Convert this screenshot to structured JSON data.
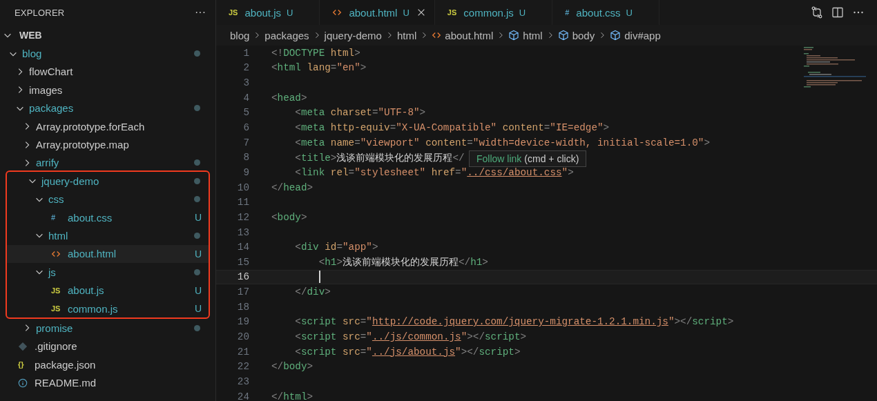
{
  "explorer": {
    "title": "EXPLORER",
    "more": "···",
    "root": {
      "name": "WEB",
      "expanded": true,
      "children": [
        {
          "name": "blog",
          "kind": "folder",
          "expanded": true,
          "modified": true,
          "selected": false,
          "children": [
            {
              "name": "flowChart",
              "kind": "folder",
              "expanded": false,
              "modified": false,
              "selected": false
            },
            {
              "name": "images",
              "kind": "folder",
              "expanded": false,
              "modified": false,
              "selected": false
            },
            {
              "name": "packages",
              "kind": "folder",
              "expanded": true,
              "modified": true,
              "selected": false,
              "children": [
                {
                  "name": "Array.prototype.forEach",
                  "kind": "folder",
                  "expanded": false,
                  "modified": false,
                  "selected": false
                },
                {
                  "name": "Array.prototype.map",
                  "kind": "folder",
                  "expanded": false,
                  "modified": false,
                  "selected": false
                },
                {
                  "name": "arrify",
                  "kind": "folder",
                  "expanded": false,
                  "modified": true,
                  "selected": false
                },
                {
                  "name": "jquery-demo",
                  "kind": "folder",
                  "expanded": true,
                  "modified": true,
                  "selected": false,
                  "highlighted": true,
                  "children": [
                    {
                      "name": "css",
                      "kind": "folder",
                      "expanded": true,
                      "modified": true,
                      "selected": false,
                      "children": [
                        {
                          "name": "about.css",
                          "kind": "css",
                          "glyph": "#",
                          "status": "U",
                          "selected": false
                        }
                      ]
                    },
                    {
                      "name": "html",
                      "kind": "folder",
                      "expanded": true,
                      "modified": true,
                      "selected": false,
                      "children": [
                        {
                          "name": "about.html",
                          "kind": "html",
                          "status": "U",
                          "selected": true
                        }
                      ]
                    },
                    {
                      "name": "js",
                      "kind": "folder",
                      "expanded": true,
                      "modified": true,
                      "selected": false,
                      "children": [
                        {
                          "name": "about.js",
                          "kind": "js",
                          "glyph": "JS",
                          "status": "U",
                          "selected": false
                        },
                        {
                          "name": "common.js",
                          "kind": "js",
                          "glyph": "JS",
                          "status": "U",
                          "selected": false
                        }
                      ]
                    }
                  ]
                },
                {
                  "name": "promise",
                  "kind": "folder",
                  "expanded": false,
                  "modified": true,
                  "selected": false
                }
              ]
            }
          ]
        },
        {
          "name": ".gitignore",
          "kind": "git",
          "selected": false
        },
        {
          "name": "package.json",
          "kind": "json",
          "glyph": "{}",
          "selected": false
        },
        {
          "name": "README.md",
          "kind": "info",
          "selected": false
        }
      ]
    }
  },
  "tabs": [
    {
      "label": "about.js",
      "kind": "js",
      "glyph": "JS",
      "status": "U",
      "selected": false
    },
    {
      "label": "about.html",
      "kind": "html",
      "status": "U",
      "selected": true
    },
    {
      "label": "common.js",
      "kind": "js",
      "glyph": "JS",
      "status": "U",
      "selected": false
    },
    {
      "label": "about.css",
      "kind": "css",
      "glyph": "#",
      "status": "U",
      "selected": false
    }
  ],
  "breadcrumbs": [
    {
      "label": "blog",
      "kind": "folder"
    },
    {
      "label": "packages",
      "kind": "folder"
    },
    {
      "label": "jquery-demo",
      "kind": "folder"
    },
    {
      "label": "html",
      "kind": "folder"
    },
    {
      "label": "about.html",
      "kind": "html"
    },
    {
      "label": "html",
      "kind": "element"
    },
    {
      "label": "body",
      "kind": "element"
    },
    {
      "label": "div#app",
      "kind": "element"
    }
  ],
  "lines": [
    {
      "number": "1",
      "current": false,
      "text": "<!DOCTYPE html>"
    },
    {
      "number": "2",
      "current": false,
      "text": "<html lang=\"en\">"
    },
    {
      "number": "3",
      "current": false
    },
    {
      "number": "4",
      "current": false,
      "text": "<head>"
    },
    {
      "number": "5",
      "current": false,
      "text": "    <meta charset=\"UTF-8\">"
    },
    {
      "number": "6",
      "current": false,
      "text": "    <meta http-equiv=\"X-UA-Compatible\" content=\"IE=edge\">"
    },
    {
      "number": "7",
      "current": false,
      "text": "    <meta name=\"viewport\" content=\"width=device-width, initial-scale=1.0\">"
    },
    {
      "number": "8",
      "current": false,
      "text": "    <title>浅谈前端模块化的发展历程</"
    },
    {
      "number": "9",
      "current": false,
      "text": "    <link rel=\"stylesheet\" href=\"../css/about.css\">"
    },
    {
      "number": "10",
      "current": false,
      "text": "</head>"
    },
    {
      "number": "11",
      "current": false
    },
    {
      "number": "12",
      "current": false,
      "text": "<body>"
    },
    {
      "number": "13",
      "current": false
    },
    {
      "number": "14",
      "current": false,
      "text": "    <div id=\"app\">"
    },
    {
      "number": "15",
      "current": false,
      "text": "        <h1>浅谈前端模块化的发展历程</h1>"
    },
    {
      "number": "16",
      "current": true
    },
    {
      "number": "17",
      "current": false,
      "text": "    </div>"
    },
    {
      "number": "18",
      "current": false
    },
    {
      "number": "19",
      "current": false,
      "text": "    <script src=\"http://code.jquery.com/jquery-migrate-1.2.1.min.js\"></script>"
    },
    {
      "number": "20",
      "current": false,
      "text": "    <script src=\"../js/common.js\"></script>"
    },
    {
      "number": "21",
      "current": false,
      "text": "    <script src=\"../js/about.js\"></script>"
    },
    {
      "number": "22",
      "current": false,
      "text": "</body>"
    },
    {
      "number": "23",
      "current": false
    },
    {
      "number": "24",
      "current": false,
      "text": "</html>"
    }
  ],
  "tooltip": {
    "link": "Follow link",
    "hint": "(cmd + click)"
  }
}
